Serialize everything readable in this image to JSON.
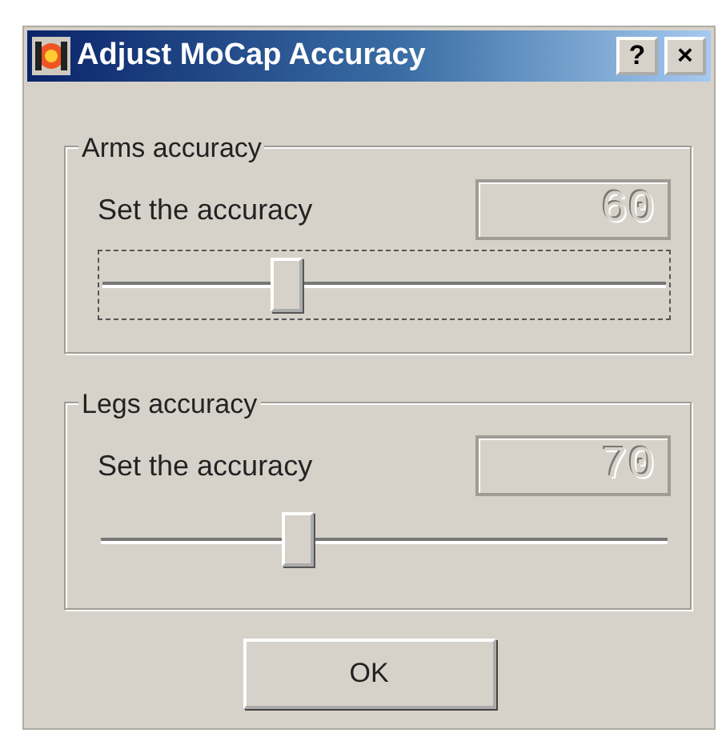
{
  "window": {
    "title": "Adjust MoCap Accuracy",
    "help_button": "?",
    "close_button": "×"
  },
  "groups": [
    {
      "title": "Arms accuracy",
      "label": "Set the accuracy",
      "value": "60",
      "disabled": true,
      "level": 0.33,
      "focused": true
    },
    {
      "title": "Legs accuracy",
      "label": "Set the accuracy",
      "value": "70",
      "disabled": true,
      "level": 0.35,
      "focused": false
    }
  ],
  "buttons": [
    "OK"
  ]
}
